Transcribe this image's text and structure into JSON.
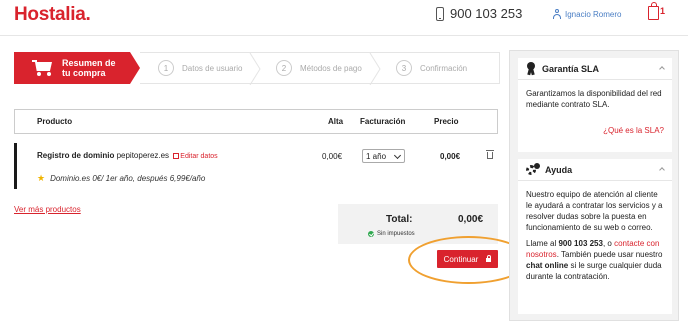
{
  "header": {
    "logo": "Hostalia.",
    "phone": "900 103 253",
    "user_name": "Ignacio Romero",
    "cart_count": "1"
  },
  "steps": [
    {
      "number": "",
      "label_line1": "Resumen de",
      "label_line2": "tu compra",
      "active": true
    },
    {
      "number": "1",
      "label": "Datos de usuario",
      "active": false
    },
    {
      "number": "2",
      "label": "Métodos de pago",
      "active": false
    },
    {
      "number": "3",
      "label": "Confirmación",
      "active": false
    }
  ],
  "table": {
    "headers": {
      "product": "Producto",
      "alta": "Alta",
      "facturacion": "Facturación",
      "precio": "Precio"
    },
    "row": {
      "product_type": "Registro de dominio",
      "domain": "pepitoperez.es",
      "edit_label": "Editar datos",
      "alta": "0,00€",
      "billing_selected": "1 año",
      "precio": "0,00€",
      "promo": "Dominio.es 0€/ 1er año, después 6,99€/año"
    }
  },
  "more_products": "Ver más productos",
  "totals": {
    "label": "Total:",
    "value": "0,00€",
    "tax_note": "Sin impuestos"
  },
  "continue_button": "Continuar",
  "sidebar": {
    "sla": {
      "title": "Garantía SLA",
      "body": "Garantizamos la disponibilidad del red mediante contrato SLA.",
      "link": "¿Qué es la SLA?"
    },
    "ayuda": {
      "title": "Ayuda",
      "body1": "Nuestro equipo de atención al cliente le ayudará a contratar los servicios y a resolver dudas sobre la puesta en funcionamiento de su web o correo.",
      "body2_pre": "Llame al ",
      "body2_phone": "900 103 253",
      "body2_mid": ", o ",
      "body2_link": "contacte con nosotros",
      "body2_mid2": ". También puede usar nuestro ",
      "body2_chat": "chat online",
      "body2_post": " si le surge cualquier duda durante la contratación."
    }
  },
  "colors": {
    "brand_red": "#d9232d",
    "highlight_orange": "#f0a030",
    "link_blue": "#4a7ec4",
    "success_green": "#2fa84f"
  }
}
